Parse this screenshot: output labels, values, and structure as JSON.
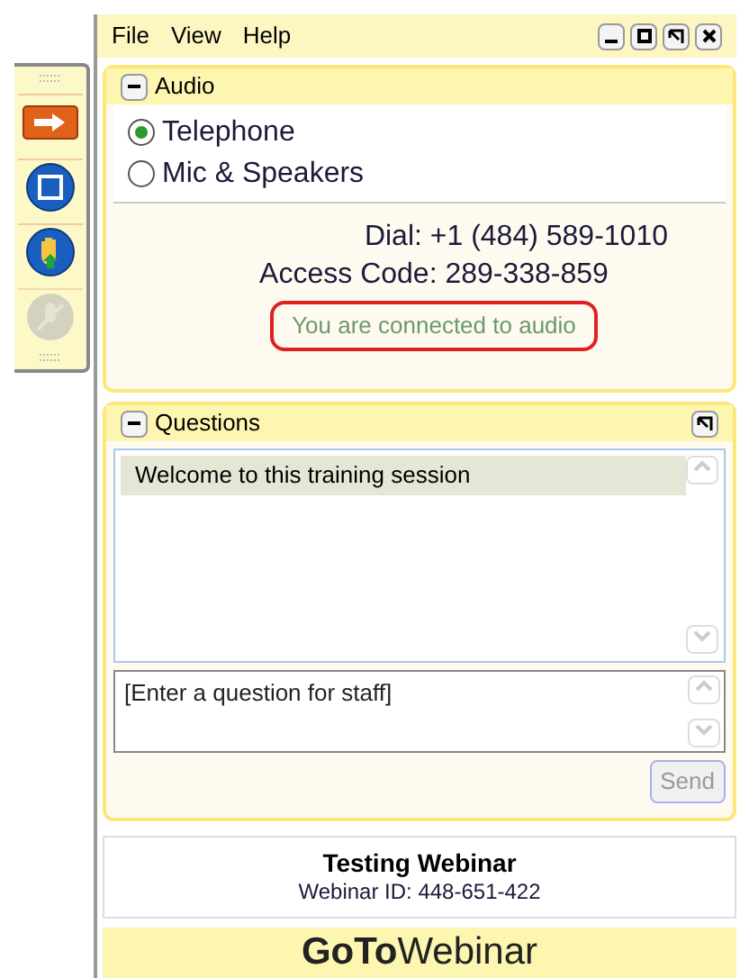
{
  "toolbar": [
    {
      "kind": "arrow",
      "disabled": false
    },
    {
      "kind": "window",
      "disabled": false
    },
    {
      "kind": "hand",
      "disabled": false
    },
    {
      "kind": "mic",
      "disabled": true
    }
  ],
  "menu": [
    "File",
    "View",
    "Help"
  ],
  "audio": {
    "title": "Audio",
    "options": [
      {
        "label": "Telephone",
        "selected": true
      },
      {
        "label": "Mic & Speakers",
        "selected": false
      }
    ],
    "dial": "Dial: +1 (484) 589-1010",
    "access_code": "Access Code: 289-338-859",
    "status": "You are connected to audio"
  },
  "questions": {
    "title": "Questions",
    "messages": [
      {
        "text": "Welcome to this training session",
        "selected": true
      }
    ],
    "input": {
      "placeholder": "[Enter a question for staff]"
    },
    "send": {
      "label": "Send",
      "disabled": true
    }
  },
  "webinar": {
    "title": "Testing Webinar",
    "id": "Webinar ID: 448-651-422"
  },
  "logo": "**GoTo**Webinar"
}
